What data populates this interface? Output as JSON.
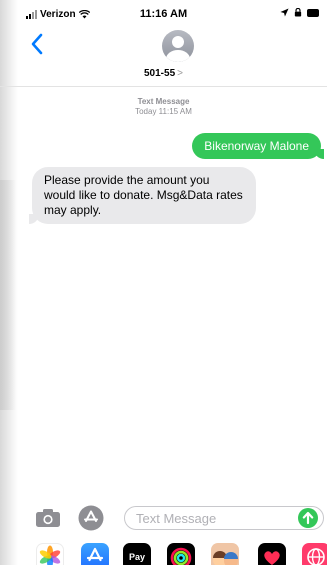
{
  "status_bar": {
    "carrier": "Verizon",
    "time": "11:16 AM"
  },
  "header": {
    "contact_name": "501-55",
    "detail_chevron": ">"
  },
  "thread": {
    "service_label": "Text Message",
    "timestamp": "Today 11:15 AM",
    "messages": [
      {
        "direction": "outgoing",
        "text": "Bikenorway Malone"
      },
      {
        "direction": "incoming",
        "text": "Please provide the amount you would like to donate. Msg&Data rates may apply."
      }
    ]
  },
  "compose": {
    "placeholder": "Text Message",
    "value": ""
  },
  "app_drawer": {
    "apple_pay_label": "Pay",
    "apps": [
      "photos-icon",
      "app-store-icon",
      "apple-pay-icon",
      "fitness-icon",
      "memoji-icon",
      "heart-sticker-icon",
      "globe-icon"
    ]
  },
  "colors": {
    "accent_blue": "#007aff",
    "outgoing_bubble": "#34c759",
    "incoming_bubble": "#e9e9eb",
    "secondary_text": "#8e8e93"
  }
}
